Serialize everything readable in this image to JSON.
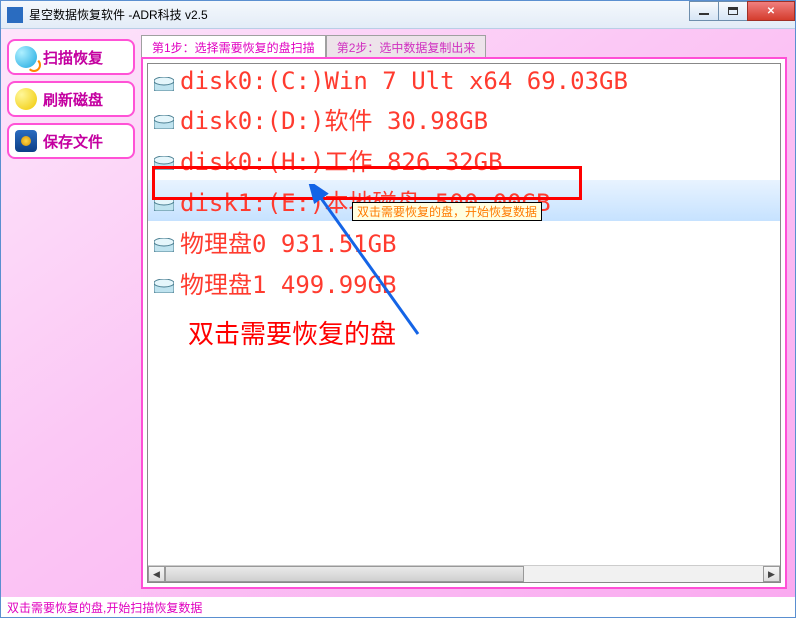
{
  "window": {
    "title": "星空数据恢复软件  -ADR科技 v2.5"
  },
  "sidebar": {
    "scan": "扫描恢复",
    "refresh": "刷新磁盘",
    "save": "保存文件"
  },
  "tabs": {
    "step1": "第1步：选择需要恢复的盘扫描",
    "step2": "第2步：选中数据复制出来"
  },
  "disks": [
    {
      "label": "disk0:(C:)Win 7 Ult x64 69.03GB"
    },
    {
      "label": "disk0:(D:)软件 30.98GB"
    },
    {
      "label": "disk0:(H:)工作 826.32GB"
    },
    {
      "label": "disk1:(E:)本地磁盘 500.00GB"
    },
    {
      "label": "物理盘0 931.51GB"
    },
    {
      "label": "物理盘1 499.99GB"
    }
  ],
  "tooltip": "双击需要恢复的盘，开始恢复数据",
  "annotation": "双击需要恢复的盘",
  "statusbar": "双击需要恢复的盘,开始扫描恢复数据"
}
